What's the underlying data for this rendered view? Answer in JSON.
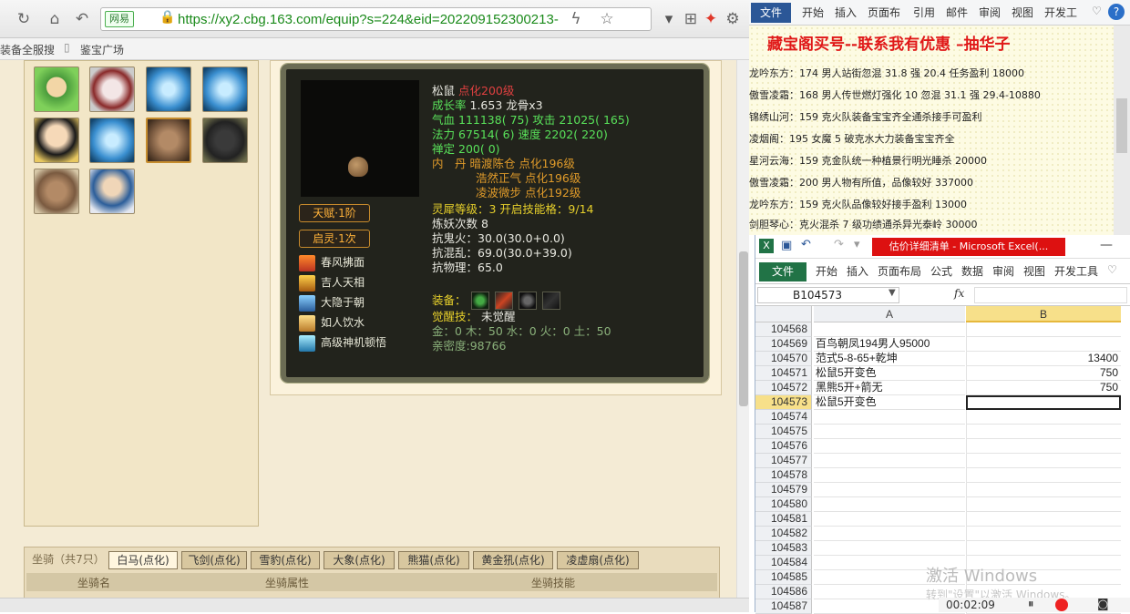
{
  "browser": {
    "url": "https://xy2.cbg.163.com/equip?s=224&eid=202209152300213-",
    "site_badge": "网易",
    "bookmarks": [
      "装备全服搜",
      "鉴宝广场"
    ]
  },
  "pet": {
    "name": "松鼠",
    "tag": "点化200级",
    "growth_label": "成长率",
    "growth": "1.653",
    "longgu": "龙骨x3",
    "hp_label": "气血",
    "hp": "111138( 75)",
    "atk_label": "攻击",
    "atk": "21025( 165)",
    "mp_label": "法力",
    "mp": "67514( 6)",
    "spd_label": "速度",
    "spd": "2202( 220)",
    "zen_label": "禅定",
    "zen": "200( 0)",
    "neidan_label": "内　丹",
    "neidan": [
      {
        "name": "暗渡陈仓",
        "level": "点化196级"
      },
      {
        "name": "浩然正气",
        "level": "点化196级"
      },
      {
        "name": "凌波微步",
        "level": "点化192级"
      }
    ],
    "lingxi": "灵犀等级：3 开启技能格：9/14",
    "lianyao": "炼妖次数 8",
    "res1": "抗鬼火：30.0(30.0+0.0)",
    "res2": "抗混乱：69.0(30.0+39.0)",
    "res3": "抗物理：65.0",
    "equip_label": "装备：",
    "awaken_label": "觉醒技：",
    "awaken": "未觉醒",
    "elements": "金：0 木：50 水：0 火：0 土：50",
    "intimacy": "亲密度:98766",
    "talent": "天赋·1阶",
    "qiling": "启灵·1次",
    "skills": [
      "春风拂面",
      "吉人天相",
      "大隐于朝",
      "如人饮水",
      "高级神机顿悟"
    ]
  },
  "tabs": {
    "count": "坐骑（共7只）",
    "items": [
      "白马(点化)",
      "飞剑(点化)",
      "雪豹(点化)",
      "大象(点化)",
      "熊猫(点化)",
      "黄金犼(点化)",
      "凌虚扇(点化)"
    ],
    "columns": [
      "坐骑名",
      "坐骑属性",
      "坐骑技能"
    ]
  },
  "word": {
    "tabs": [
      "文件",
      "开始",
      "插入",
      "页面布",
      "引用",
      "邮件",
      "审阅",
      "视图",
      "开发工"
    ],
    "title": "藏宝阁买号--联系我有优惠 –抽华子",
    "lines": [
      "龙吟东方：174 男人站街忽混 31.8 强 20.4 任务盈利 18000",
      "傲雪凌霜：168 男人传世燃灯强化 10 忽混 31.1 强 29.4-10880",
      "锦绣山河：159 克火队装备宝宝齐全通杀接手可盈利",
      "凌烟阁：195 女魔 5 破克水大力装备宝宝齐全",
      "星河云海：159 克金队统一种植景行明光睡杀 20000",
      "傲雪凌霜：200 男人物有所值，品像较好 337000",
      "龙吟东方：159 克火队品像较好接手盈利 13000",
      "剑胆琴心：克火混杀 7 级功绩通杀异光泰岭 30000"
    ]
  },
  "excel": {
    "title": "估价详细清单 - Microsoft Excel(...",
    "tabs": [
      "文件",
      "开始",
      "插入",
      "页面布局",
      "公式",
      "数据",
      "审阅",
      "视图",
      "开发工具"
    ],
    "namebox": "B104573",
    "col_a": "A",
    "col_b": "B",
    "rows": [
      {
        "n": "104568",
        "a": "",
        "b": ""
      },
      {
        "n": "104569",
        "a": "百鸟朝凤194男人95000",
        "b": ""
      },
      {
        "n": "104570",
        "a": "范式5-8-65+乾坤",
        "b": "13400"
      },
      {
        "n": "104571",
        "a": "松鼠5开变色",
        "b": "750"
      },
      {
        "n": "104572",
        "a": "黑熊5开+箭无",
        "b": "750"
      },
      {
        "n": "104573",
        "a": "松鼠5开变色",
        "b": ""
      },
      {
        "n": "104574",
        "a": "",
        "b": ""
      },
      {
        "n": "104575",
        "a": "",
        "b": ""
      },
      {
        "n": "104576",
        "a": "",
        "b": ""
      },
      {
        "n": "104577",
        "a": "",
        "b": ""
      },
      {
        "n": "104578",
        "a": "",
        "b": ""
      },
      {
        "n": "104579",
        "a": "",
        "b": ""
      },
      {
        "n": "104580",
        "a": "",
        "b": ""
      },
      {
        "n": "104581",
        "a": "",
        "b": ""
      },
      {
        "n": "104582",
        "a": "",
        "b": ""
      },
      {
        "n": "104583",
        "a": "",
        "b": ""
      },
      {
        "n": "104584",
        "a": "",
        "b": ""
      },
      {
        "n": "104585",
        "a": "",
        "b": ""
      },
      {
        "n": "104586",
        "a": "",
        "b": ""
      },
      {
        "n": "104587",
        "a": "",
        "b": ""
      }
    ]
  },
  "windows_watermark": "激活 Windows",
  "windows_watermark_sub": "转到\"设置\"以激活 Windows。",
  "recorder_time": "00:02:09"
}
